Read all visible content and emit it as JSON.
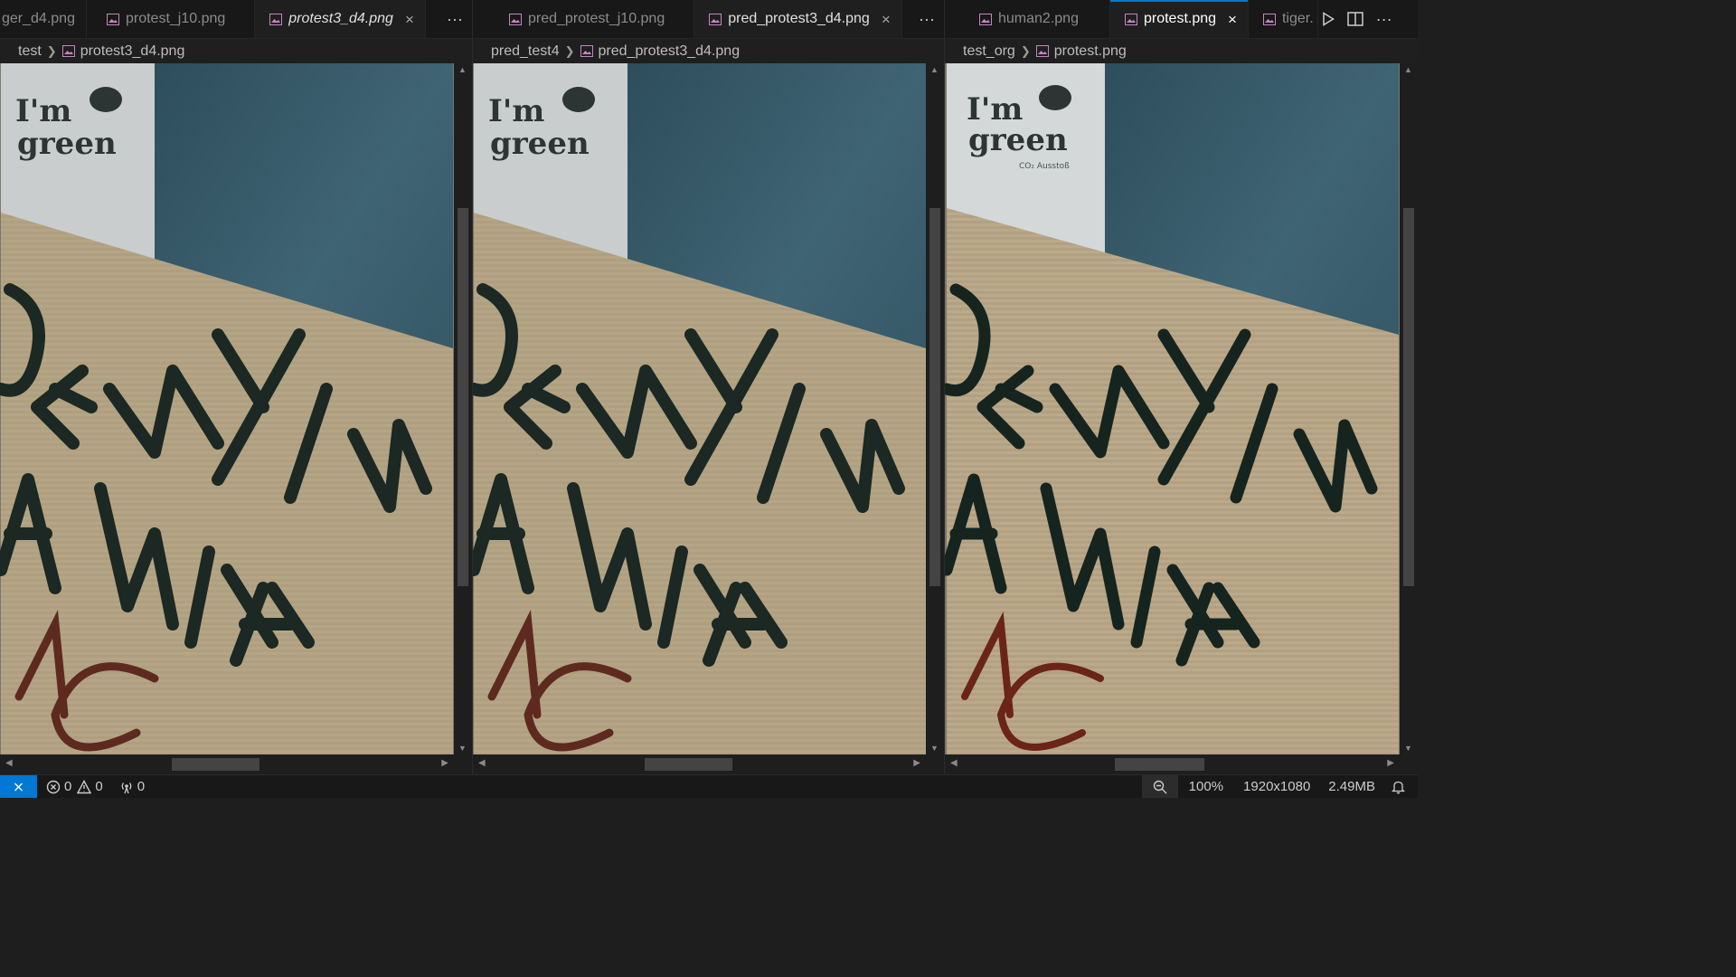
{
  "groups": [
    {
      "tabs": [
        {
          "label": "ger_d4.png",
          "active": false,
          "preview": false
        },
        {
          "label": "protest_j10.png",
          "active": false,
          "preview": false
        },
        {
          "label": "protest3_d4.png",
          "active": true,
          "preview": true,
          "close": "×"
        }
      ],
      "more": "···",
      "breadcrumb": [
        "test",
        "protest3_d4.png"
      ]
    },
    {
      "tabs": [
        {
          "label": "pred_protest_j10.png",
          "active": false,
          "preview": false
        },
        {
          "label": "pred_protest3_d4.png",
          "active": true,
          "preview": false,
          "close": "×"
        }
      ],
      "more": "···",
      "breadcrumb": [
        "pred_test4",
        "pred_protest3_d4.png"
      ]
    },
    {
      "tabs": [
        {
          "label": "human2.png",
          "active": false,
          "preview": false
        },
        {
          "label": "protest.png",
          "active": true,
          "focused": true,
          "preview": false,
          "close": "×"
        },
        {
          "label": "tiger.",
          "active": false,
          "preview": false
        }
      ],
      "more": "···",
      "breadcrumb": [
        "test_org",
        "protest.png"
      ]
    }
  ],
  "image_content": {
    "bag_text_line1": "I'm",
    "bag_text_line2": "green",
    "bag_small_text": "CO₂ Ausstoß",
    "sign_line1": "DENYING",
    "sign_line2": "ARTH",
    "sign_line3": "NG"
  },
  "statusbar": {
    "errors": "0",
    "warnings": "0",
    "ports": "0",
    "zoom": "100%",
    "dimensions": "1920x1080",
    "filesize": "2.49MB"
  },
  "colors": {
    "accent": "#0078d4",
    "image_icon": "#c586c0",
    "cardboard": "#b7a787",
    "denim": "#3c5d6a",
    "ink": "#1a2722",
    "red_ink": "#6e2a22"
  }
}
